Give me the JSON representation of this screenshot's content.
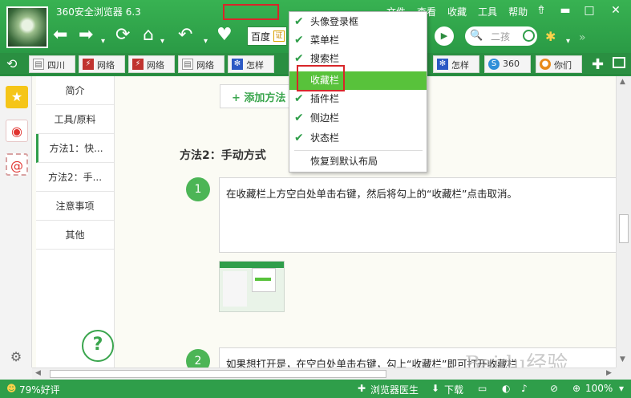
{
  "window": {
    "title": "360安全浏览器 6.3",
    "menu": [
      "文件",
      "查看",
      "收藏",
      "工具",
      "帮助"
    ],
    "controls": {
      "skin": "⇮",
      "minimize": "▬",
      "maximize": "□",
      "close": "✕"
    }
  },
  "toolbar": {
    "search_engine": "百度",
    "verified_badge": "证",
    "search_placeholder": "二孩",
    "icons": [
      "back-icon",
      "forward-icon",
      "refresh-icon",
      "home-icon",
      "undo-icon",
      "favorite-heart-icon",
      "play-icon",
      "search-icon",
      "apps-icon"
    ]
  },
  "tabs": [
    {
      "label": "四川",
      "icon": "page-icon"
    },
    {
      "label": "网络",
      "icon": "network-icon"
    },
    {
      "label": "网络",
      "icon": "network-icon"
    },
    {
      "label": "网络",
      "icon": "page-icon"
    },
    {
      "label": "怎样",
      "icon": "paw-icon"
    },
    {
      "label": "怎样",
      "icon": "paw-icon"
    },
    {
      "label": "360",
      "icon": "360-icon"
    },
    {
      "label": "你们",
      "icon": "orange-icon"
    }
  ],
  "context_menu": {
    "items": [
      {
        "label": "头像登录框",
        "checked": true
      },
      {
        "label": "菜单栏",
        "checked": true
      },
      {
        "label": "搜索栏",
        "checked": true
      },
      {
        "label": "收藏栏",
        "checked": false,
        "highlighted": true
      },
      {
        "label": "插件栏",
        "checked": true
      },
      {
        "label": "侧边栏",
        "checked": true
      },
      {
        "label": "状态栏",
        "checked": true
      }
    ],
    "reset_label": "恢复到默认布局"
  },
  "side_nav": [
    {
      "label": "简介"
    },
    {
      "label": "工具/原料"
    },
    {
      "label": "方法1：快..."
    },
    {
      "label": "方法2：手..."
    },
    {
      "label": "注意事项"
    },
    {
      "label": "其他"
    }
  ],
  "article": {
    "add_method_label": "+ 添加方法",
    "section_title": "方法2：手动方式",
    "steps": [
      {
        "num": "1",
        "text": "在收藏栏上方空白处单击右键，然后将勾上的“收藏栏”点击取消。"
      },
      {
        "num": "2",
        "text": "如果想打开是，在空白处单击右键，勾上“收藏栏”即可打开收藏栏"
      }
    ],
    "watermark": "Baidu经验"
  },
  "statusbar": {
    "rating": "79%好评",
    "doctor": "浏览器医生",
    "download": "下载",
    "zoom": "100%"
  },
  "colors": {
    "brand_green": "#2f9e4a",
    "highlight_green": "#58c23b",
    "annotation_red": "#d8262a"
  }
}
